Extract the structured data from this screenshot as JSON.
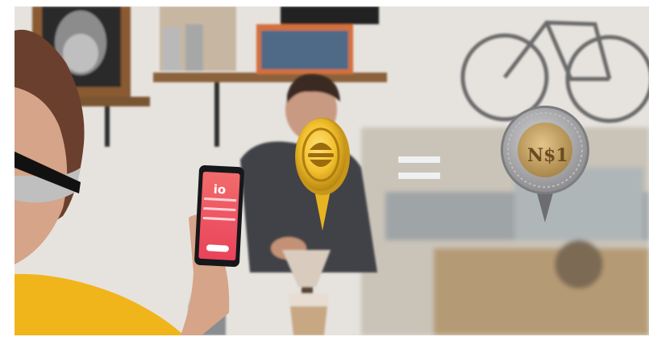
{
  "scene": {
    "subjects": [
      "portrait-frame",
      "shelf",
      "barista",
      "phone",
      "coffee-cup",
      "bicycle",
      "customer"
    ],
    "overlay": {
      "crypto_coin": "gold-coin-icon",
      "equals": "equals-sign-icon",
      "peso_coin": "mexican-one-peso-coin-icon",
      "peso_coin_label": "N$1"
    },
    "phone_screen": {
      "app_logo": "io",
      "accent_color": "#ef4a5a"
    },
    "colors": {
      "wall": "#e6e3de",
      "yellow_sleeve": "#f1b51c",
      "barista_shirt": "#3f4346",
      "gold": "#f2c12e",
      "coin_silver": "#a9a9ab",
      "coin_gold": "#cfa865"
    }
  }
}
